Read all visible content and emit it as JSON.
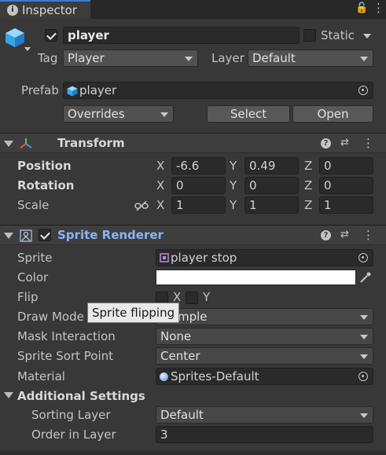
{
  "tab": {
    "title": "Inspector"
  },
  "object": {
    "name": "player",
    "active": true,
    "static_label": "Static",
    "static_checked": false,
    "tag_label": "Tag",
    "tag_value": "Player",
    "layer_label": "Layer",
    "layer_value": "Default"
  },
  "prefab": {
    "label": "Prefab",
    "value": "player",
    "overrides_label": "Overrides",
    "select_label": "Select",
    "open_label": "Open"
  },
  "transform": {
    "title": "Transform",
    "position_label": "Position",
    "rotation_label": "Rotation",
    "scale_label": "Scale",
    "axes": [
      "X",
      "Y",
      "Z"
    ],
    "position": [
      "-6.6",
      "0.49",
      "0"
    ],
    "rotation": [
      "0",
      "0",
      "0"
    ],
    "scale": [
      "1",
      "1",
      "1"
    ]
  },
  "sprite_renderer": {
    "title": "Sprite Renderer",
    "enabled": true,
    "sprite_label": "Sprite",
    "sprite_value": "player stop",
    "color_label": "Color",
    "color_value": "#ffffff",
    "flip_label": "Flip",
    "flip_x": "X",
    "flip_y": "Y",
    "tooltip": "Sprite flipping",
    "draw_mode_label": "Draw Mode",
    "draw_mode_value": "Simple",
    "draw_mode_visible": "mple",
    "mask_label": "Mask Interaction",
    "mask_value": "None",
    "sort_point_label": "Sprite Sort Point",
    "sort_point_value": "Center",
    "material_label": "Material",
    "material_value": "Sprites-Default",
    "additional_label": "Additional Settings",
    "sorting_layer_label": "Sorting Layer",
    "sorting_layer_value": "Default",
    "order_label": "Order in Layer",
    "order_value": "3"
  },
  "colors": {
    "accent": "#8ab4f8",
    "panel": "#383838",
    "field": "#2a2a2a"
  }
}
